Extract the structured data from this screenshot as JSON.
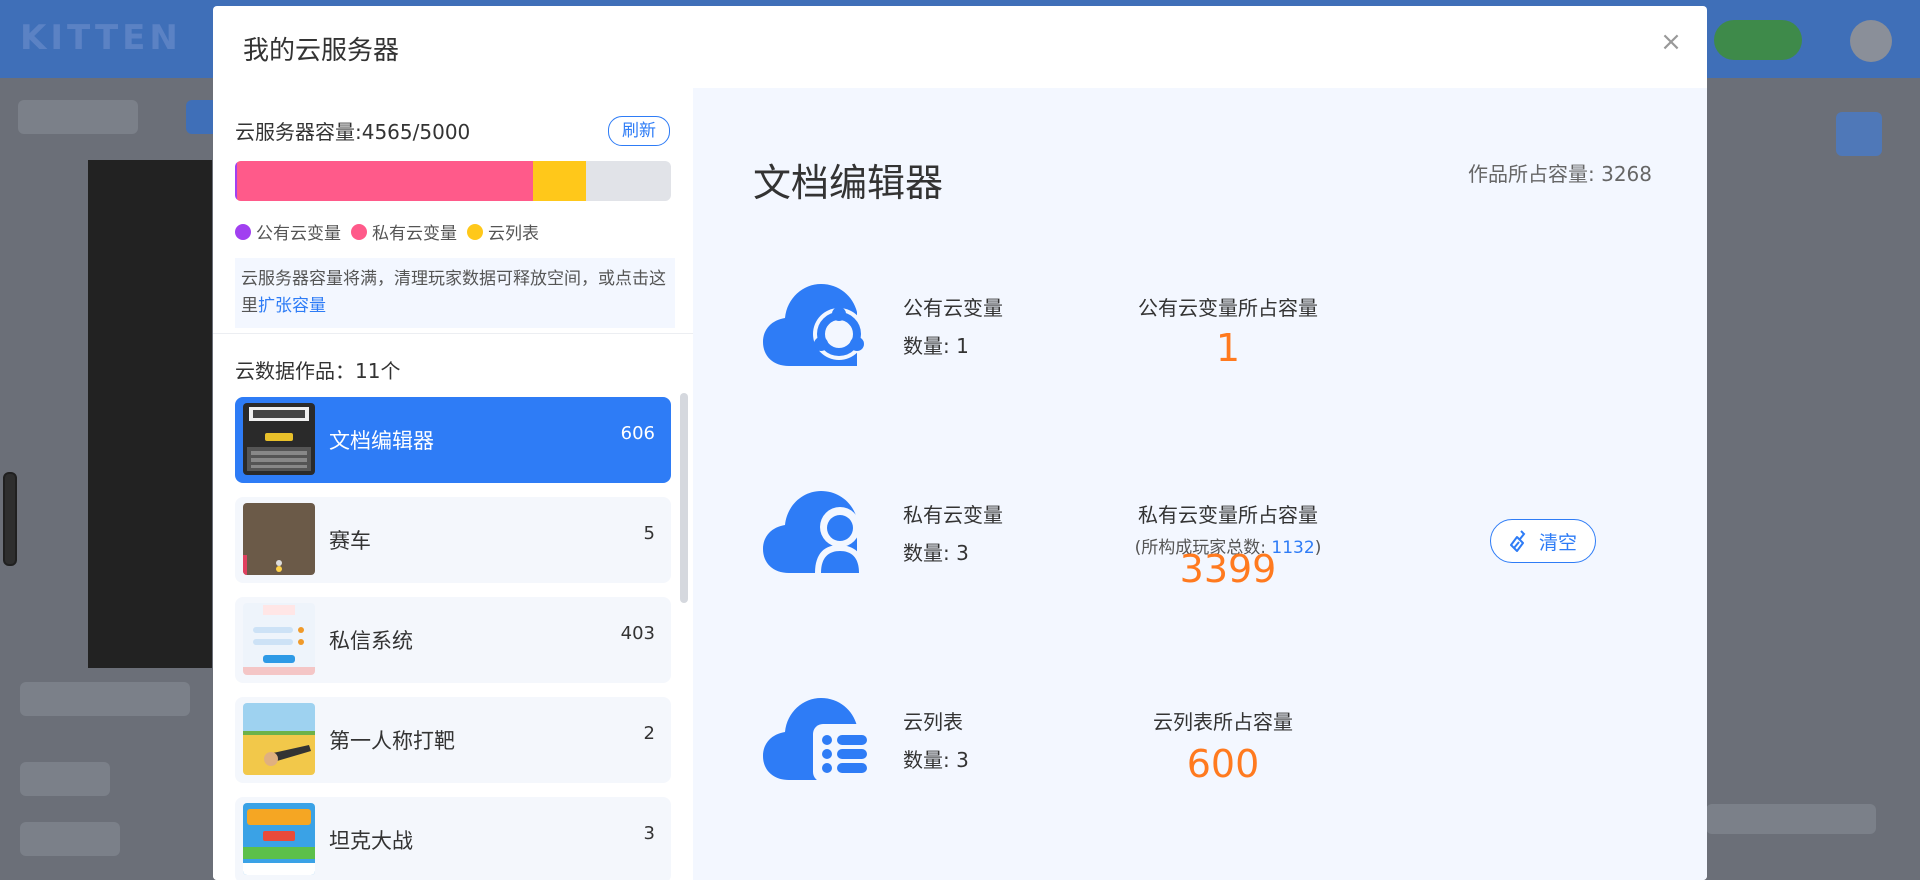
{
  "background": {
    "logo": "KITTEN"
  },
  "modal": {
    "title": "我的云服务器",
    "close_icon": "close-icon"
  },
  "capacity": {
    "label": "云服务器容量:4565/5000",
    "used": 4565,
    "total": 5000,
    "refresh_label": "刷新",
    "segments": [
      {
        "name": "公有云变量",
        "color": "#a140f0",
        "value": 1
      },
      {
        "name": "私有云变量",
        "color": "#ff5a8a",
        "value": 3399
      },
      {
        "name": "云列表",
        "color": "#ffc81a",
        "value": 600
      }
    ],
    "notice_text": "云服务器容量将满，清理玩家数据可释放空间，或点击这里",
    "notice_link": "扩张容量"
  },
  "works": {
    "label": "云数据作品：11个",
    "items": [
      {
        "name": "文档编辑器",
        "count": "606",
        "selected": true
      },
      {
        "name": "赛车",
        "count": "5",
        "selected": false
      },
      {
        "name": "私信系统",
        "count": "403",
        "selected": false
      },
      {
        "name": "第一人称打靶",
        "count": "2",
        "selected": false
      },
      {
        "name": "坦克大战",
        "count": "3",
        "selected": false
      }
    ]
  },
  "detail": {
    "title": "文档编辑器",
    "size_label": "作品所占容量: 3268",
    "public": {
      "name": "公有云变量",
      "count_label": "数量: 1",
      "cap_label": "公有云变量所占容量",
      "value": "1"
    },
    "private": {
      "name": "私有云变量",
      "count_label": "数量: 3",
      "cap_label": "私有云变量所占容量",
      "sub_prefix": "(所构成玩家总数: ",
      "sub_value": "1132",
      "sub_suffix": ")",
      "value": "3399",
      "clear_label": "清空",
      "clear_icon": "broom-icon"
    },
    "list": {
      "name": "云列表",
      "count_label": "数量: 3",
      "cap_label": "云列表所占容量",
      "value": "600"
    }
  }
}
